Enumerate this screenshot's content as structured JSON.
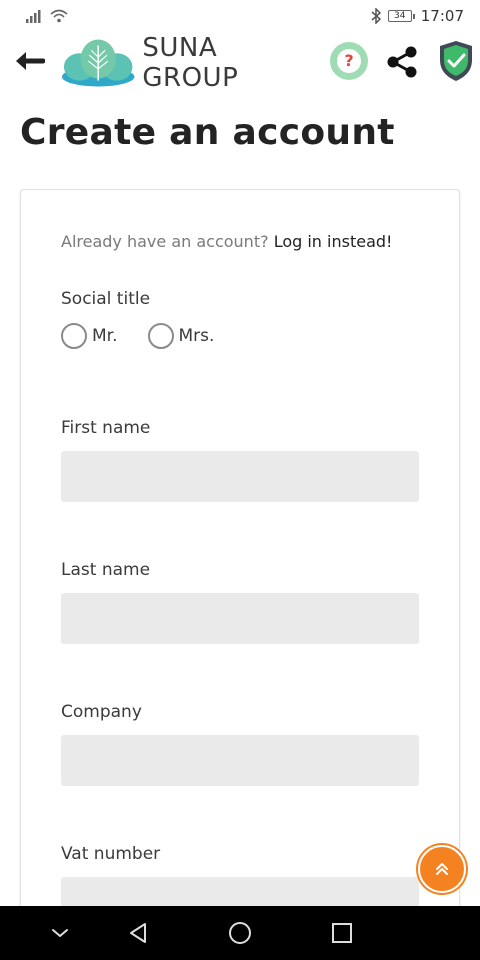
{
  "status_bar": {
    "battery_level": "34",
    "time": "17:07"
  },
  "header": {
    "logo_text": "SUNA GROUP",
    "help_symbol": "?"
  },
  "page": {
    "title": "Create an account"
  },
  "form": {
    "login_prompt": "Already have an account?",
    "login_link": "Log in instead!",
    "social_title_label": "Social title",
    "social_title_options": [
      "Mr.",
      "Mrs."
    ],
    "first_name_label": "First name",
    "first_name_value": "",
    "last_name_label": "Last name",
    "last_name_value": "",
    "company_label": "Company",
    "company_value": "",
    "vat_label": "Vat number",
    "vat_value": ""
  },
  "colors": {
    "accent_orange": "#f58220",
    "input_background": "#eaeaea",
    "logo_teal": "#3fb3a8",
    "help_green": "#9fdcb4",
    "shield_green": "#3fba6a"
  }
}
